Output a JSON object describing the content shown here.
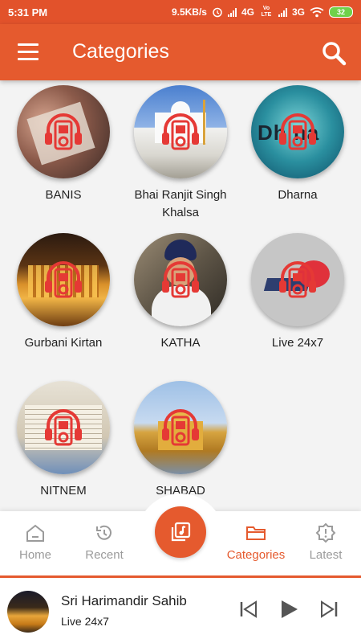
{
  "status_bar": {
    "time": "5:31 PM",
    "speed": "9.5KB/s",
    "network_1": "4G",
    "volte": "Vo LTE",
    "network_2": "3G",
    "battery": "32"
  },
  "app_bar": {
    "title": "Categories",
    "menu_icon": "hamburger-menu-icon",
    "search_icon": "search-icon"
  },
  "categories": [
    {
      "label": "BANIS",
      "image": "hands-holding-book"
    },
    {
      "label": "Bhai Ranjit Singh Khalsa",
      "image": "white-gurdwara"
    },
    {
      "label": "Dharna",
      "image": "teal-dharna-text"
    },
    {
      "label": "Gurbani Kirtan",
      "image": "golden-temple-night"
    },
    {
      "label": "KATHA",
      "image": "speaker-with-turban"
    },
    {
      "label": "Live 24x7",
      "image": "streaming-logo"
    },
    {
      "label": "NITNEM",
      "image": "open-prayer-book"
    },
    {
      "label": "SHABAD",
      "image": "golden-temple-day"
    }
  ],
  "category_overlay_icon": "headphones-player-icon",
  "bottom_nav": {
    "items": [
      {
        "label": "Home",
        "icon": "home-icon",
        "active": false
      },
      {
        "label": "Recent",
        "icon": "history-icon",
        "active": false
      },
      {
        "label": "Categories",
        "icon": "folder-icon",
        "active": true
      },
      {
        "label": "Latest",
        "icon": "alert-badge-icon",
        "active": false
      }
    ],
    "center_icon": "music-library-icon"
  },
  "player": {
    "title": "Sri Harimandir Sahib",
    "subtitle": "Live 24x7",
    "controls": [
      "skip-previous-icon",
      "play-icon",
      "skip-next-icon"
    ]
  },
  "colors": {
    "accent": "#e55a2e",
    "status_bar": "#e2522b",
    "background": "#f3f3f3",
    "nav_inactive": "#9b9b9b"
  }
}
